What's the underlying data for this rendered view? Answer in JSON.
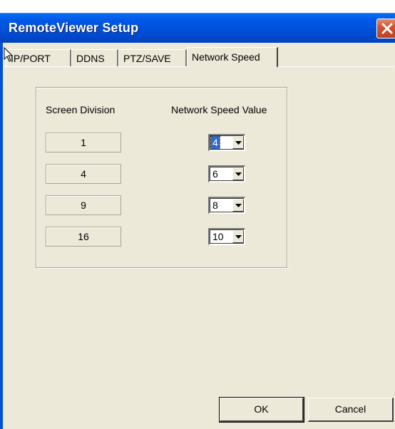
{
  "window": {
    "title": "RemoteViewer Setup",
    "title_color": "#FFFFFF",
    "titlebar_color": "#0054E3",
    "close_icon": "close-icon"
  },
  "tabs": [
    {
      "label": "IP/PORT",
      "active": false
    },
    {
      "label": "DDNS",
      "active": false
    },
    {
      "label": "PTZ/SAVE",
      "active": false
    },
    {
      "label": "Network Speed",
      "active": true
    }
  ],
  "network_speed": {
    "col_screen_division": "Screen Division",
    "col_speed_value": "Network Speed Value",
    "rows": [
      {
        "division": "1",
        "speed": "4"
      },
      {
        "division": "4",
        "speed": "6"
      },
      {
        "division": "9",
        "speed": "8"
      },
      {
        "division": "16",
        "speed": "10"
      }
    ]
  },
  "buttons": {
    "ok": "OK",
    "cancel": "Cancel"
  },
  "colors": {
    "dialog_bg": "#ECE9D8",
    "selection": "#316AC5",
    "close_button": "#D4532E"
  }
}
